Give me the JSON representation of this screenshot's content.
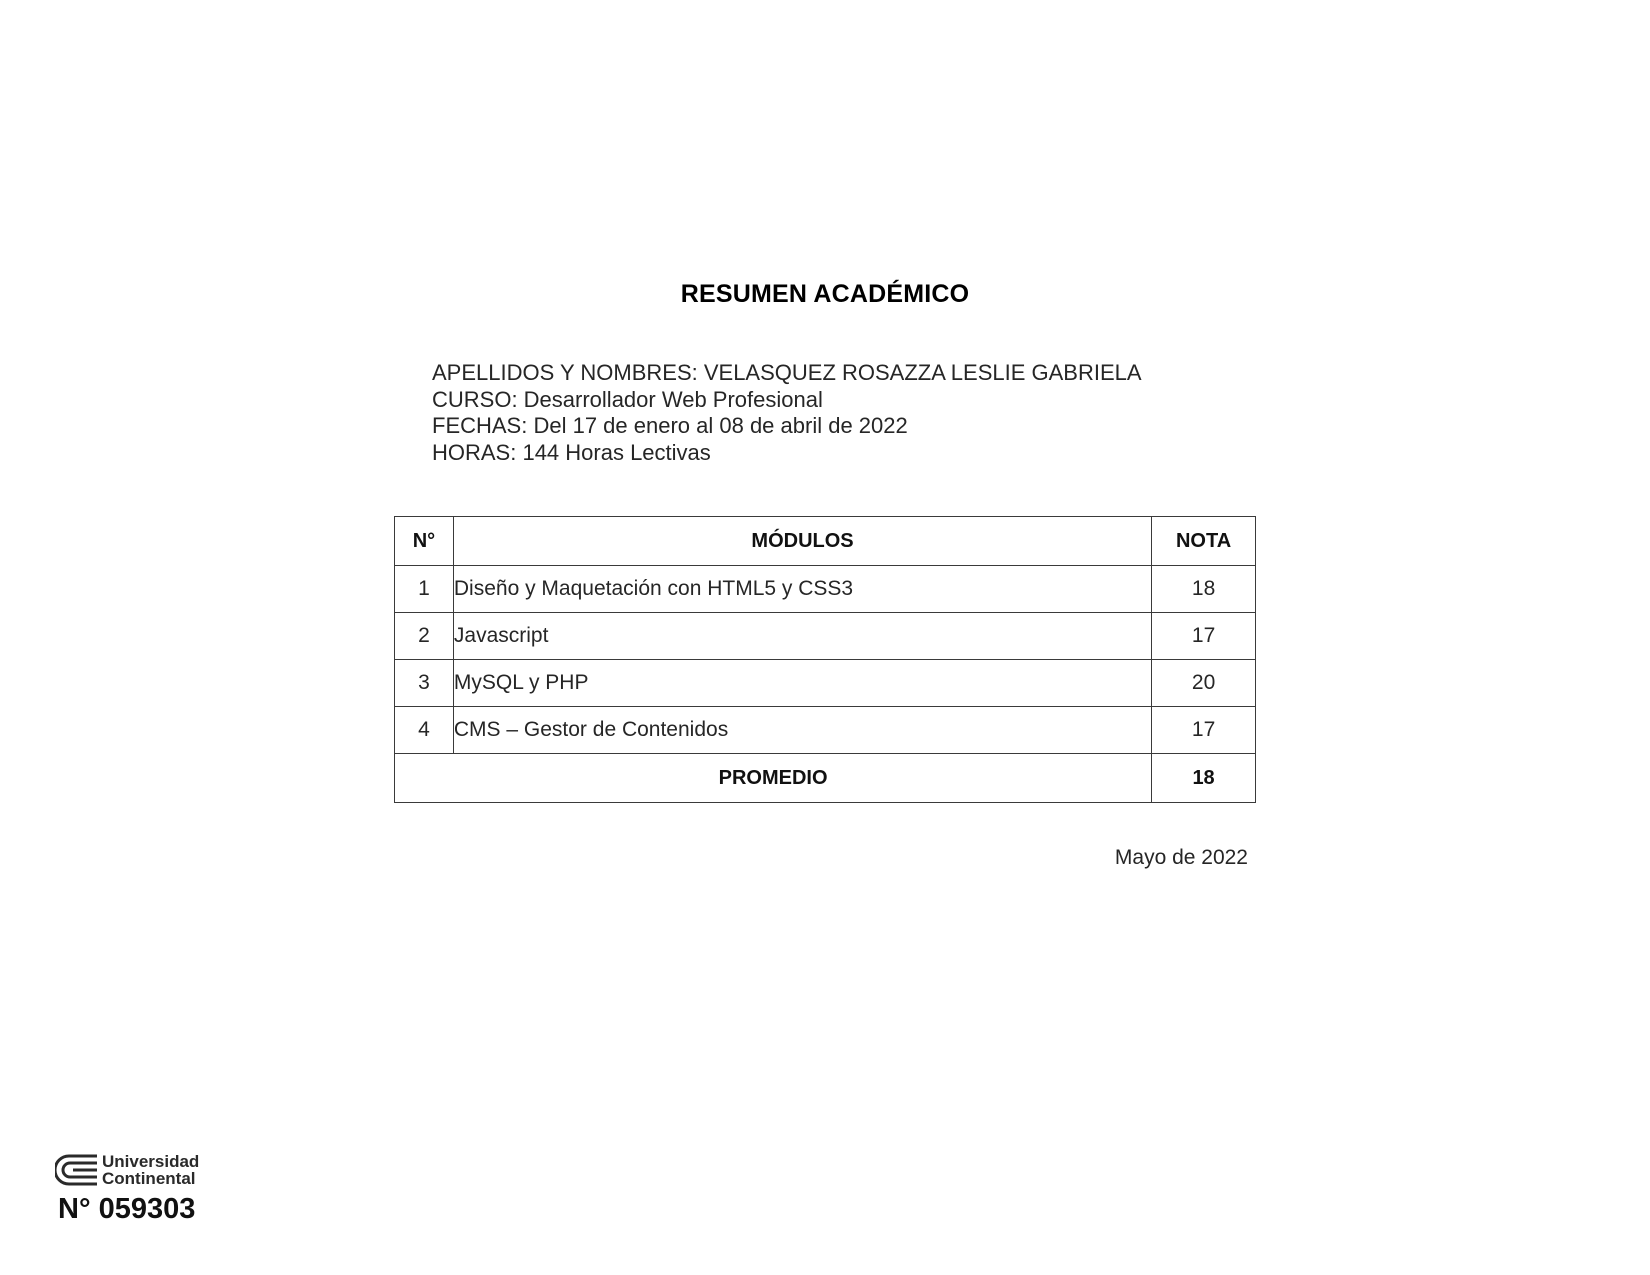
{
  "document": {
    "title": "RESUMEN ACADÉMICO",
    "info": {
      "name_line": "APELLIDOS Y NOMBRES: VELASQUEZ ROSAZZA LESLIE GABRIELA",
      "course_line": "CURSO: Desarrollador Web Profesional",
      "dates_line": "FECHAS: Del 17 de enero al 08 de abril de 2022",
      "hours_line": "HORAS: 144 Horas Lectivas"
    },
    "table": {
      "headers": {
        "number": "N°",
        "modules": "MÓDULOS",
        "grade": "NOTA"
      },
      "rows": [
        {
          "number": "1",
          "module": "Diseño y Maquetación con HTML5 y CSS3",
          "grade": "18"
        },
        {
          "number": "2",
          "module": "Javascript",
          "grade": "17"
        },
        {
          "number": "3",
          "module": "MySQL y PHP",
          "grade": "20"
        },
        {
          "number": "4",
          "module": "CMS – Gestor de Contenidos",
          "grade": "17"
        }
      ],
      "average_label": "PROMEDIO",
      "average_value": "18"
    },
    "date": "Mayo de 2022",
    "logo": {
      "line1": "Universidad",
      "line2": "Continental",
      "icon": "university-continental-logo"
    },
    "serial_number": "N° 059303"
  }
}
